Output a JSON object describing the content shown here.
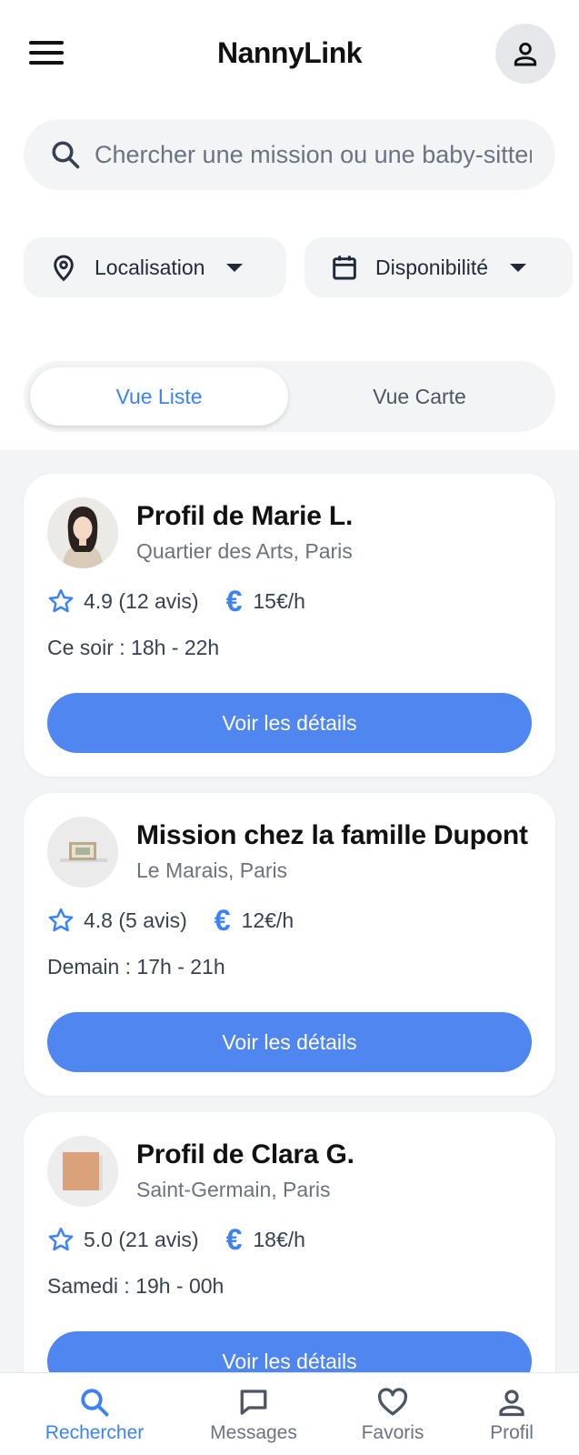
{
  "header": {
    "title": "NannyLink",
    "menu_icon": "hamburger-menu-icon",
    "profile_icon": "user-icon"
  },
  "search": {
    "placeholder": "Chercher une mission ou une baby-sitter...",
    "icon": "search-icon"
  },
  "filters": [
    {
      "label": "Localisation",
      "icon": "map-pin-icon"
    },
    {
      "label": "Disponibilité",
      "icon": "calendar-icon"
    }
  ],
  "view_toggle": {
    "active": "Vue Liste",
    "inactive": "Vue Carte"
  },
  "cards": [
    {
      "title": "Profil de Marie L.",
      "location": "Quartier des Arts, Paris",
      "rating": "4.9 (12 avis)",
      "rate": "15€/h",
      "availability": "Ce soir : 18h - 22h",
      "cta": "Voir les détails"
    },
    {
      "title": "Mission chez la famille Dupont",
      "location": "Le Marais, Paris",
      "rating": "4.8 (5 avis)",
      "rate": "12€/h",
      "availability": "Demain : 17h - 21h",
      "cta": "Voir les détails"
    },
    {
      "title": "Profil de Clara G.",
      "location": "Saint-Germain, Paris",
      "rating": "5.0 (21 avis)",
      "rate": "18€/h",
      "availability": "Samedi : 19h - 00h",
      "cta": "Voir les détails"
    }
  ],
  "bottom_nav": [
    {
      "label": "Rechercher",
      "icon": "search-icon",
      "active": true
    },
    {
      "label": "Messages",
      "icon": "message-icon",
      "active": false
    },
    {
      "label": "Favoris",
      "icon": "heart-icon",
      "active": false
    },
    {
      "label": "Profil",
      "icon": "user-icon",
      "active": false
    }
  ],
  "colors": {
    "accent": "#3b82f6",
    "button": "#4f86f0",
    "surface": "#f3f4f6"
  }
}
